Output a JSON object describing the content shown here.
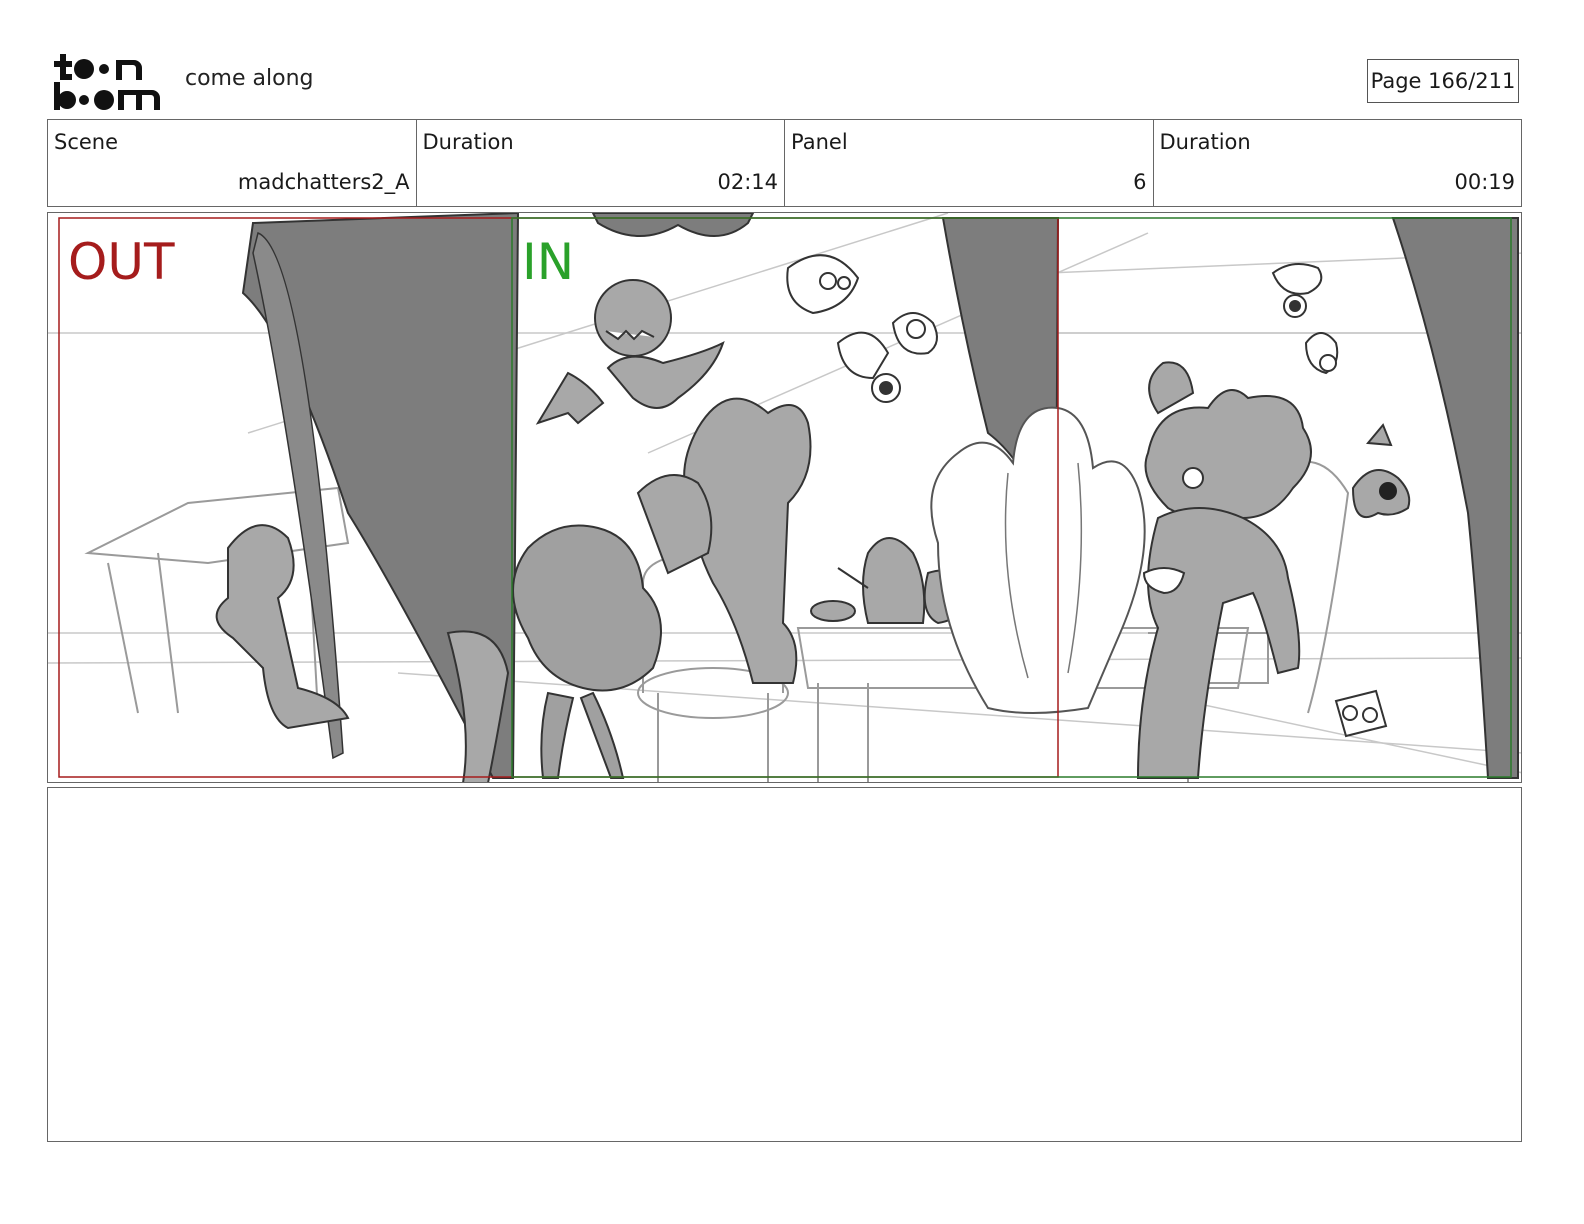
{
  "header": {
    "logo_text": "toon boom",
    "project_title": "come along",
    "page_indicator": "Page 166/211"
  },
  "info": {
    "scene_label": "Scene",
    "scene_value": "madchatters2_A",
    "scene_duration_label": "Duration",
    "scene_duration_value": "02:14",
    "panel_label": "Panel",
    "panel_value": "6",
    "panel_duration_label": "Duration",
    "panel_duration_value": "00:19"
  },
  "panel": {
    "out_marker": "OUT",
    "in_marker": "IN",
    "out_color": "#a51c1c",
    "in_color": "#2aa12a"
  },
  "notes": {
    "text": ""
  }
}
